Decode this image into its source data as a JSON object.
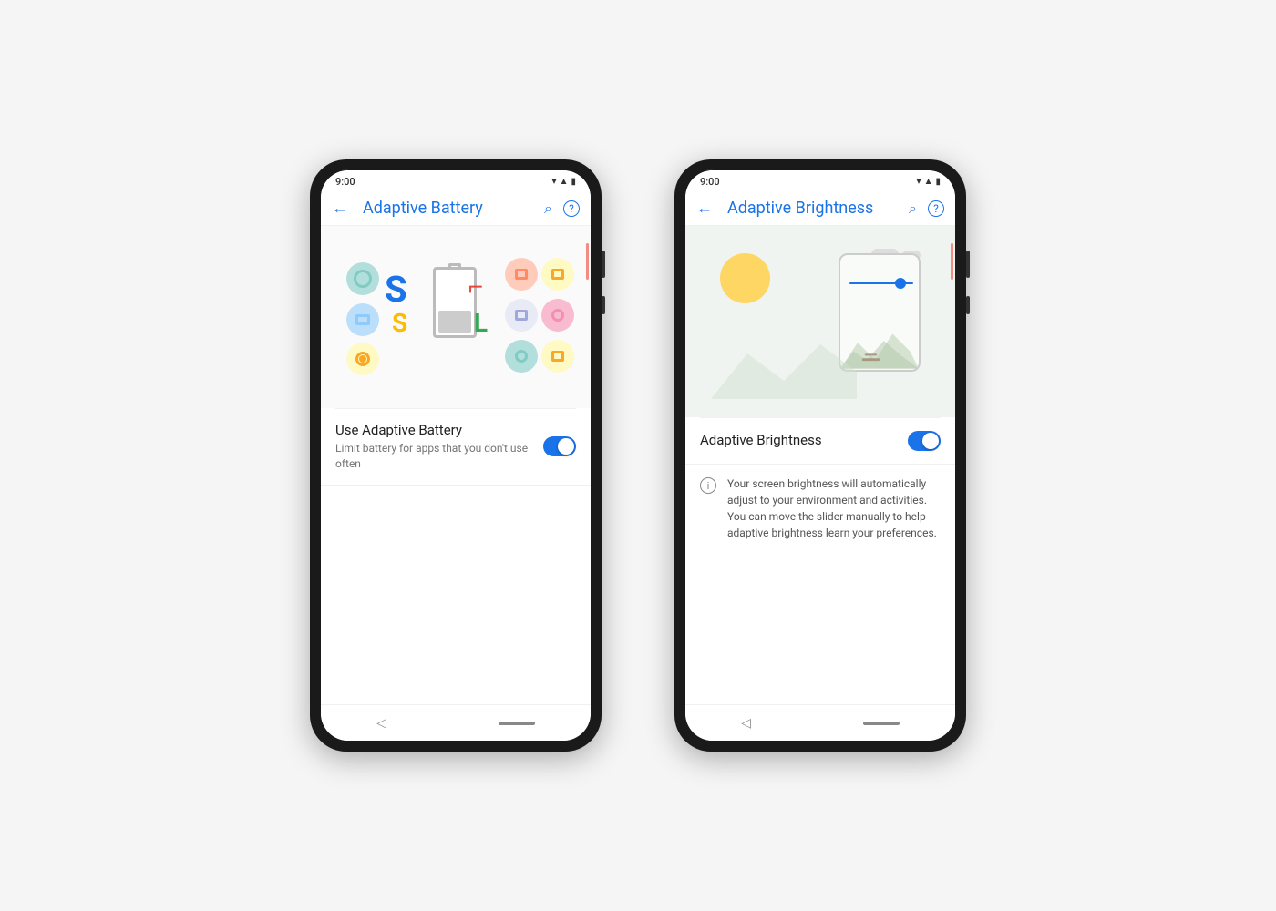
{
  "phones": [
    {
      "id": "adaptive-battery",
      "status_time": "9:00",
      "app_bar": {
        "title": "Adaptive Battery",
        "back_label": "←",
        "search_label": "⌕",
        "help_label": "?"
      },
      "setting": {
        "title": "Use Adaptive Battery",
        "subtitle": "Limit battery for apps that you don't use often",
        "toggle_on": true
      }
    },
    {
      "id": "adaptive-brightness",
      "status_time": "9:00",
      "app_bar": {
        "title": "Adaptive Brightness",
        "back_label": "←",
        "search_label": "⌕",
        "help_label": "?"
      },
      "setting": {
        "title": "Adaptive Brightness",
        "toggle_on": true
      },
      "info_text": "Your screen brightness will automatically adjust to your environment and activities. You can move the slider manually to help adaptive brightness learn your preferences."
    }
  ]
}
